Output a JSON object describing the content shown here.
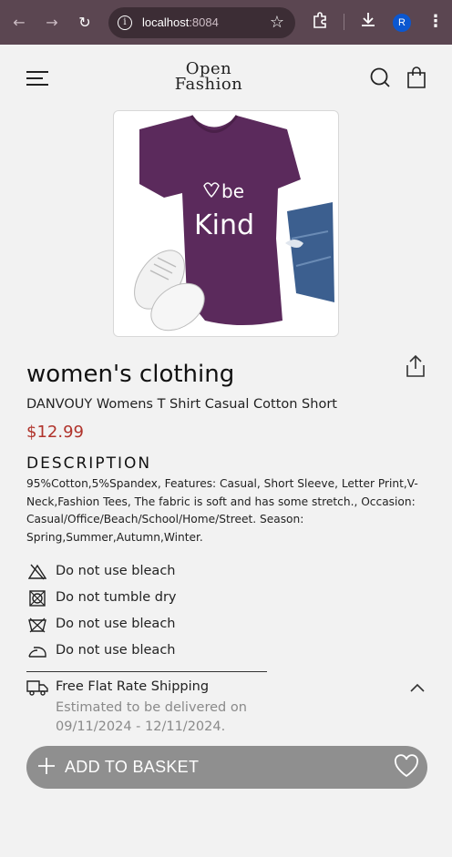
{
  "browser": {
    "url_host": "localhost",
    "url_port": ":8084",
    "profile_initial": "R"
  },
  "header": {
    "logo_line1": "Open",
    "logo_line2": "Fashion"
  },
  "product": {
    "image_print_line1": "be",
    "image_print_line2": "Kind",
    "category": "women's clothing",
    "name": "DANVOUY Womens T Shirt Casual Cotton Short",
    "price": "$12.99",
    "description_heading": "DESCRIPTION",
    "description": "95%Cotton,5%Spandex, Features: Casual, Short Sleeve, Letter Print,V-Neck,Fashion Tees, The fabric is soft and has some stretch., Occasion: Casual/Office/Beach/School/Home/Street. Season: Spring,Summer,Autumn,Winter."
  },
  "care": [
    {
      "icon": "no-bleach-icon",
      "label": "Do not use bleach"
    },
    {
      "icon": "no-tumble-dry-icon",
      "label": "Do not tumble dry"
    },
    {
      "icon": "no-bleach-crossed-icon",
      "label": "Do not use bleach"
    },
    {
      "icon": "iron-icon",
      "label": "Do not use bleach"
    }
  ],
  "shipping": {
    "title": "Free Flat Rate Shipping",
    "estimate": "Estimated to be delivered on 09/11/2024 - 12/11/2024."
  },
  "actions": {
    "add_to_basket": "ADD TO BASKET"
  },
  "colors": {
    "price": "#b0332b",
    "basket_bg": "#8f8f8f",
    "chrome_bg": "#5b4651"
  }
}
